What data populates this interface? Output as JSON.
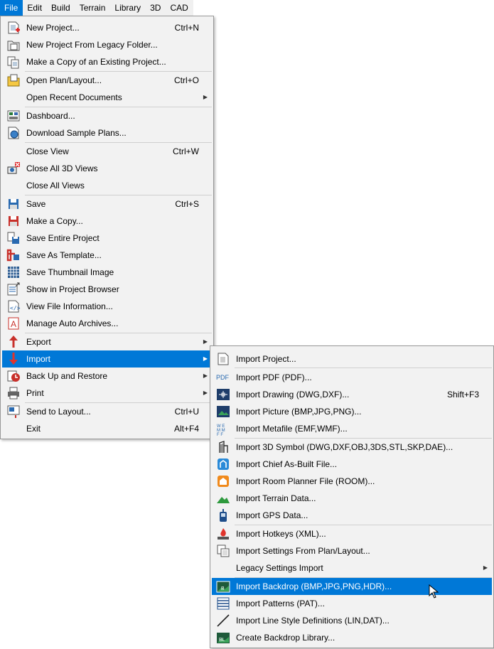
{
  "menubar": {
    "items": [
      "File",
      "Edit",
      "Build",
      "Terrain",
      "Library",
      "3D",
      "CAD"
    ]
  },
  "file_menu": {
    "items": [
      {
        "label": "New Project...",
        "shortcut": "Ctrl+N",
        "icon": "new-project-icon"
      },
      {
        "label": "New Project From Legacy Folder...",
        "shortcut": "",
        "icon": "legacy-folder-icon"
      },
      {
        "label": "Make a Copy of an Existing Project...",
        "shortcut": "",
        "icon": "copy-project-icon"
      },
      {
        "label": "Open Plan/Layout...",
        "shortcut": "Ctrl+O",
        "icon": "open-folder-icon"
      },
      {
        "label": "Open Recent Documents",
        "shortcut": "",
        "icon": "",
        "submenu": true
      },
      {
        "label": "Dashboard...",
        "shortcut": "",
        "icon": "dashboard-icon"
      },
      {
        "label": "Download Sample Plans...",
        "shortcut": "",
        "icon": "download-globe-icon"
      },
      {
        "label": "Close View",
        "shortcut": "Ctrl+W",
        "icon": ""
      },
      {
        "label": "Close All 3D Views",
        "shortcut": "",
        "icon": "close-3d-views-icon"
      },
      {
        "label": "Close All Views",
        "shortcut": "",
        "icon": ""
      },
      {
        "label": "Save",
        "shortcut": "Ctrl+S",
        "icon": "save-disk-icon"
      },
      {
        "label": "Make a Copy...",
        "shortcut": "",
        "icon": "save-copy-icon"
      },
      {
        "label": "Save Entire Project",
        "shortcut": "",
        "icon": "save-project-icon"
      },
      {
        "label": "Save As Template...",
        "shortcut": "",
        "icon": "save-template-icon"
      },
      {
        "label": "Save Thumbnail Image",
        "shortcut": "",
        "icon": "thumbnail-grid-icon"
      },
      {
        "label": "Show in Project Browser",
        "shortcut": "",
        "icon": "project-browser-icon"
      },
      {
        "label": "View File Information...",
        "shortcut": "",
        "icon": "file-info-icon"
      },
      {
        "label": "Manage Auto Archives...",
        "shortcut": "",
        "icon": "archive-icon"
      },
      {
        "label": "Export",
        "shortcut": "",
        "icon": "export-arrow-icon",
        "submenu": true
      },
      {
        "label": "Import",
        "shortcut": "",
        "icon": "import-arrow-icon",
        "submenu": true
      },
      {
        "label": "Back Up and Restore",
        "shortcut": "",
        "icon": "backup-restore-icon",
        "submenu": true
      },
      {
        "label": "Print",
        "shortcut": "",
        "icon": "printer-icon",
        "submenu": true
      },
      {
        "label": "Send to Layout...",
        "shortcut": "Ctrl+U",
        "icon": "send-layout-icon"
      },
      {
        "label": "Exit",
        "shortcut": "Alt+F4",
        "icon": ""
      }
    ]
  },
  "import_menu": {
    "items": [
      {
        "label": "Import Project...",
        "shortcut": "",
        "icon": "import-project-icon"
      },
      {
        "label": "Import PDF (PDF)...",
        "shortcut": "",
        "icon": "pdf-icon",
        "icon_text": "PDF"
      },
      {
        "label": "Import Drawing (DWG,DXF)...",
        "shortcut": "Shift+F3",
        "icon": "drawing-icon"
      },
      {
        "label": "Import Picture (BMP,JPG,PNG)...",
        "shortcut": "",
        "icon": "picture-icon"
      },
      {
        "label": "Import Metafile (EMF,WMF)...",
        "shortcut": "",
        "icon": "metafile-icon"
      },
      {
        "label": "Import 3D Symbol (DWG,DXF,OBJ,3DS,STL,SKP,DAE)...",
        "shortcut": "",
        "icon": "3d-symbol-icon"
      },
      {
        "label": "Import Chief As-Built File...",
        "shortcut": "",
        "icon": "as-built-icon"
      },
      {
        "label": "Import Room Planner File (ROOM)...",
        "shortcut": "",
        "icon": "room-planner-icon"
      },
      {
        "label": "Import Terrain Data...",
        "shortcut": "",
        "icon": "terrain-icon"
      },
      {
        "label": "Import GPS Data...",
        "shortcut": "",
        "icon": "gps-icon"
      },
      {
        "label": "Import Hotkeys (XML)...",
        "shortcut": "",
        "icon": "hotkeys-icon"
      },
      {
        "label": "Import Settings From Plan/Layout...",
        "shortcut": "",
        "icon": "settings-import-icon"
      },
      {
        "label": "Legacy Settings Import",
        "shortcut": "",
        "icon": "",
        "submenu": true
      },
      {
        "label": "Import Backdrop (BMP,JPG,PNG,HDR)...",
        "shortcut": "",
        "icon": "backdrop-icon"
      },
      {
        "label": "Import Patterns (PAT)...",
        "shortcut": "",
        "icon": "patterns-icon"
      },
      {
        "label": "Import Line Style Definitions (LIN,DAT)...",
        "shortcut": "",
        "icon": "line-style-icon"
      },
      {
        "label": "Create Backdrop Library...",
        "shortcut": "",
        "icon": "backdrop-library-icon"
      }
    ]
  },
  "colors": {
    "highlight": "#0078d7",
    "menu_bg": "#f2f2f2"
  }
}
